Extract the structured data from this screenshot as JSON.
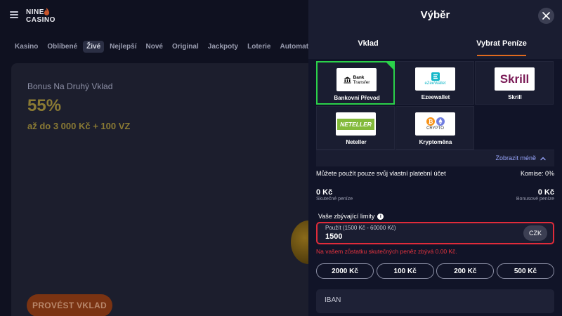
{
  "bg": {
    "logo_line1": "NINE",
    "logo_line2": "CASINO",
    "nav": [
      "Kasino",
      "Oblíbené",
      "Živé",
      "Nejlepší",
      "Nové",
      "Original",
      "Jackpoty",
      "Loterie",
      "Automaty Drop"
    ],
    "nav_active_index": 2,
    "banner": {
      "title": "Bonus Na Druhý Vklad",
      "percent": "55%",
      "subtitle": "až do 3 000 Kč + 100 VZ",
      "button": "PROVÉST VKLAD"
    }
  },
  "panel": {
    "title": "Výběr",
    "tabs": [
      {
        "label": "Vklad",
        "active": false
      },
      {
        "label": "Vybrat Peníze",
        "active": true
      }
    ],
    "methods": [
      {
        "label": "Bankovní Převod",
        "logo": "bank-transfer",
        "logo_text": [
          "Bank",
          "Transfer"
        ],
        "selected": true
      },
      {
        "label": "Ezeewallet",
        "logo": "ezeewallet",
        "logo_text": [
          "eZeeWallet"
        ],
        "selected": false
      },
      {
        "label": "Skrill",
        "logo": "skrill",
        "logo_text": [
          "Skrill"
        ],
        "selected": false
      },
      {
        "label": "Neteller",
        "logo": "neteller",
        "logo_text": [
          "NETELLER"
        ],
        "selected": false
      },
      {
        "label": "Kryptoměna",
        "logo": "crypto",
        "logo_text": [
          "CRYPTO"
        ],
        "selected": false
      }
    ],
    "show_less": "Zobrazit méně",
    "own_account_note": "Můžete použít pouze svůj vlastní platební účet",
    "commission": "Komise: 0%",
    "real_amount": "0 Kč",
    "real_label": "Skutečné peníze",
    "bonus_amount": "0 Kč",
    "bonus_label": "Bonusové peníze",
    "limits_label": "Vaše zbývající limity",
    "amount_field": {
      "label": "Použít (1500 Kč - 60000 Kč)",
      "value": "1500",
      "currency": "CZK"
    },
    "error": "Na vašem zůstatku skutečných peněz zbývá 0.00 Kč.",
    "presets": [
      "2000 Kč",
      "100 Kč",
      "200 Kč",
      "500 Kč"
    ],
    "iban_placeholder": "IBAN"
  },
  "colors": {
    "accent_orange": "#e06a1e",
    "selected_green": "#2bd14a",
    "error_red": "#e8343f",
    "link_blue": "#9aa7ff"
  }
}
